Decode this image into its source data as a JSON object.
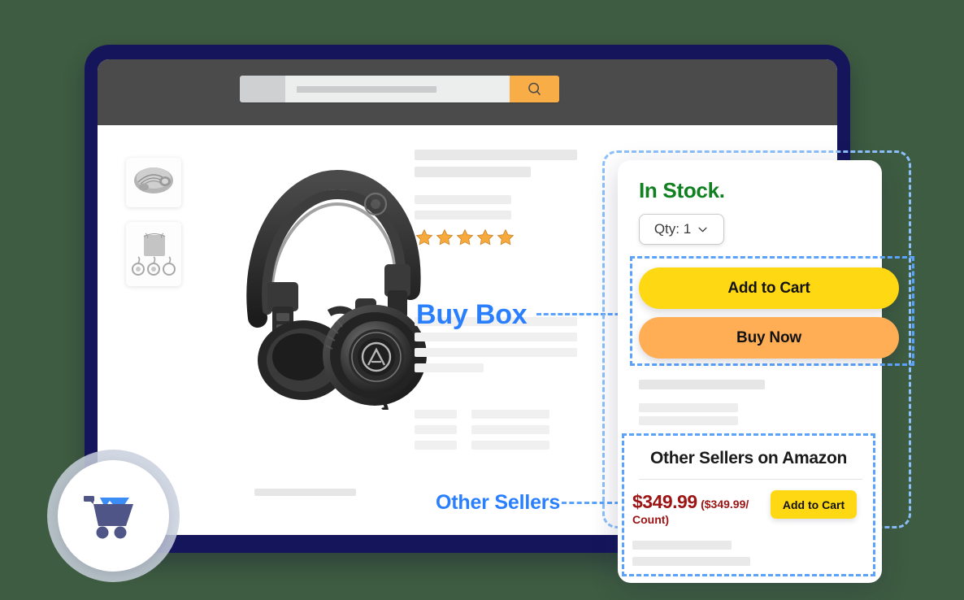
{
  "scene": {
    "background_color": "#3e5c41",
    "device_frame_color": "#15155c",
    "browser_bar_color": "#4b4b4b",
    "accent_blue": "#2a7fff",
    "dash_blue": "#5aa2fb"
  },
  "browser": {
    "search_icon": "search-icon",
    "search_button_color": "#f9ad46",
    "search_placeholder": ""
  },
  "product": {
    "thumbnails": [
      {
        "name": "headphones-thumbnail",
        "alt": "Headphones folded"
      },
      {
        "name": "accessories-thumbnail",
        "alt": "Pouch and cables"
      }
    ],
    "hero_image_alt": "Black over-ear studio headphones",
    "rating_stars": 5,
    "star_color": "#f7a93b"
  },
  "annotations": {
    "buy_box_label": "Buy Box",
    "other_sellers_label": "Other Sellers"
  },
  "buy_box": {
    "availability": "In Stock.",
    "availability_color": "#108020",
    "qty_label": "Qty: 1",
    "qty_chevron_icon": "chevron-down-icon",
    "add_to_cart_label": "Add to Cart",
    "add_to_cart_color": "#fed813",
    "buy_now_label": "Buy Now",
    "buy_now_color": "#ffae56"
  },
  "other_sellers": {
    "title": "Other Sellers on Amazon",
    "price": "$349.99",
    "unit_price": "($349.99/ Count)",
    "price_color": "#9c1414",
    "add_to_cart_label": "Add to Cart",
    "add_to_cart_color": "#fed813"
  },
  "cart_badge": {
    "icon": "mining-cart-icon",
    "body_color": "#4f5687",
    "peak_color": "#3b8cf5"
  }
}
